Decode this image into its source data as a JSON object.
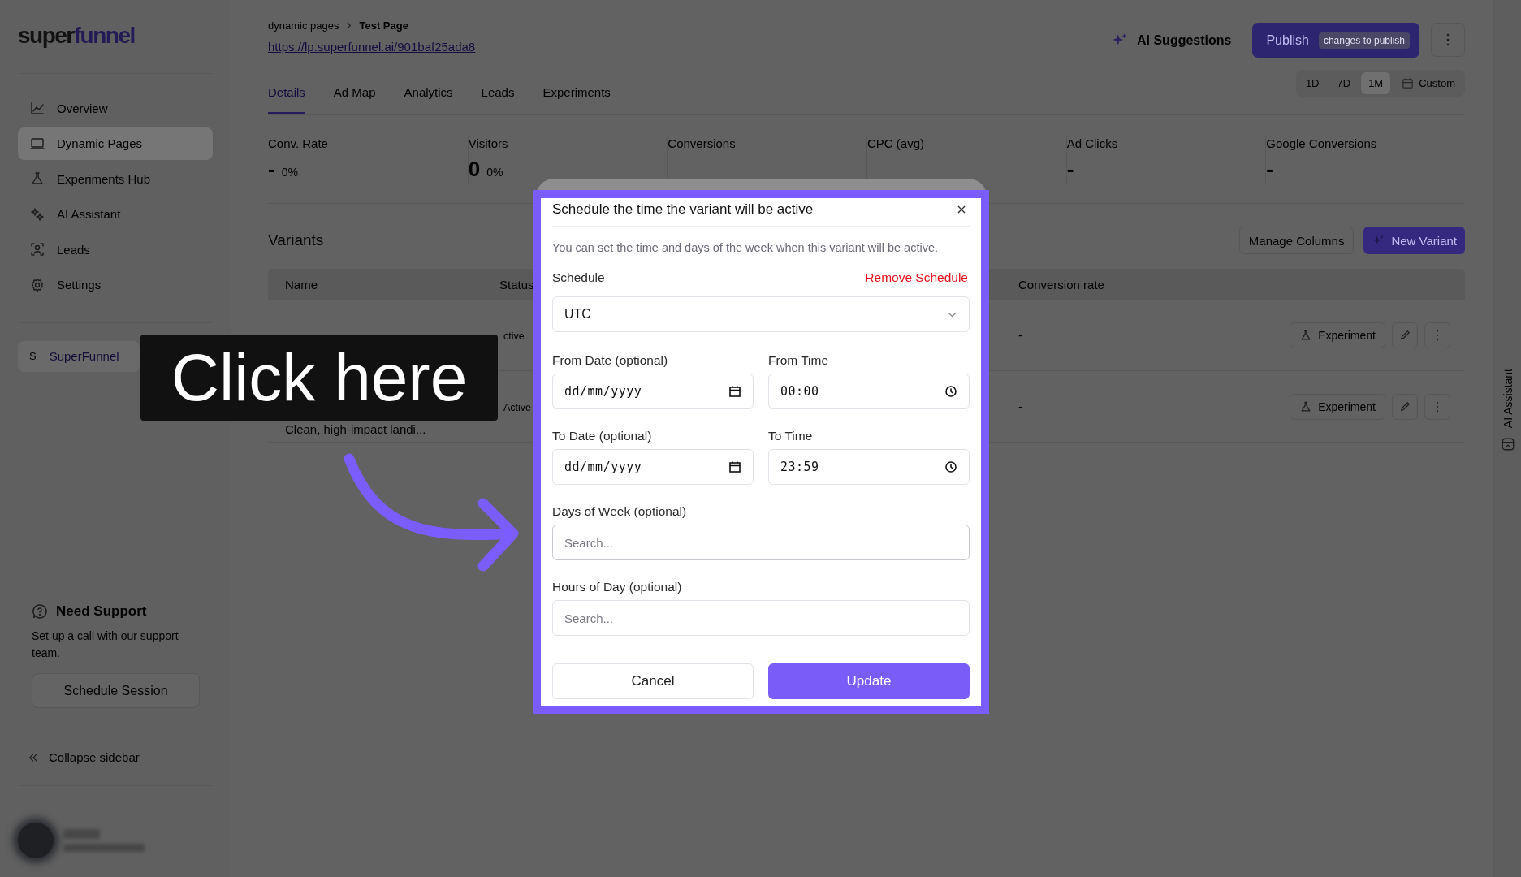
{
  "sidebar": {
    "logo": {
      "first": "super",
      "second": "funnel"
    },
    "nav": [
      {
        "label": "Overview",
        "selected": false
      },
      {
        "label": "Dynamic Pages",
        "selected": true
      },
      {
        "label": "Experiments Hub",
        "selected": false
      },
      {
        "label": "AI Assistant",
        "selected": false
      },
      {
        "label": "Leads",
        "selected": false
      },
      {
        "label": "Settings",
        "selected": false
      }
    ],
    "workspace": {
      "initial": "S",
      "name": "SuperFunnel"
    },
    "support": {
      "title": "Need Support",
      "text": "Set up a call with our support team.",
      "button": "Schedule Session"
    },
    "collapse": "Collapse sidebar"
  },
  "header": {
    "breadcrumb": [
      "dynamic pages",
      "Test Page"
    ],
    "url": "https://lp.superfunnel.ai/901baf25ada8",
    "ai_suggestions": "AI Suggestions",
    "publish": {
      "label": "Publish",
      "badge": "changes to publish"
    }
  },
  "tabs": [
    {
      "label": "Details",
      "selected": true
    },
    {
      "label": "Ad Map",
      "selected": false
    },
    {
      "label": "Analytics",
      "selected": false
    },
    {
      "label": "Leads",
      "selected": false
    },
    {
      "label": "Experiments",
      "selected": false
    }
  ],
  "ranges": [
    {
      "label": "1D",
      "selected": false
    },
    {
      "label": "7D",
      "selected": false
    },
    {
      "label": "1M",
      "selected": true
    }
  ],
  "custom_range": "Custom",
  "stats": [
    {
      "label": "Conv. Rate",
      "value": "-",
      "change": "0%"
    },
    {
      "label": "Visitors",
      "value": "0",
      "change": "0%"
    },
    {
      "label": "Conversions"
    },
    {
      "label": "CPC (avg)"
    },
    {
      "label": "Ad Clicks",
      "value": "-"
    },
    {
      "label": "Google Conversions",
      "value": "-"
    }
  ],
  "variants": {
    "title": "Variants",
    "manage_button": "Manage Columns",
    "new_button": "New Variant",
    "columns": [
      "Name",
      "Status",
      "Conversion rate"
    ],
    "rows": [
      {
        "status": "ctive",
        "conversion_rate": "-",
        "action": "Experiment"
      },
      {
        "description": "Clean, high-impact landi...",
        "status": "Active",
        "conversion_rate": "-",
        "action": "Experiment"
      }
    ]
  },
  "side_panel": {
    "label": "AI Assistant"
  },
  "annotation": {
    "text": "Click here"
  },
  "modal": {
    "title": "Schedule the time the variant will be active",
    "description": "You can set the time and days of the week when this variant will be active.",
    "schedule_label": "Schedule",
    "remove": "Remove Schedule",
    "timezone": "UTC",
    "from_date": {
      "label": "From Date (optional)",
      "value": "dd/mm/yyyy"
    },
    "from_time": {
      "label": "From Time",
      "value": "00:00"
    },
    "to_date": {
      "label": "To Date (optional)",
      "value": "dd/mm/yyyy"
    },
    "to_time": {
      "label": "To Time",
      "value": "23:59"
    },
    "days": {
      "label": "Days of Week (optional)",
      "placeholder": "Search..."
    },
    "hours": {
      "label": "Hours of Day (optional)",
      "placeholder": "Search..."
    },
    "cancel": "Cancel",
    "update": "Update"
  }
}
